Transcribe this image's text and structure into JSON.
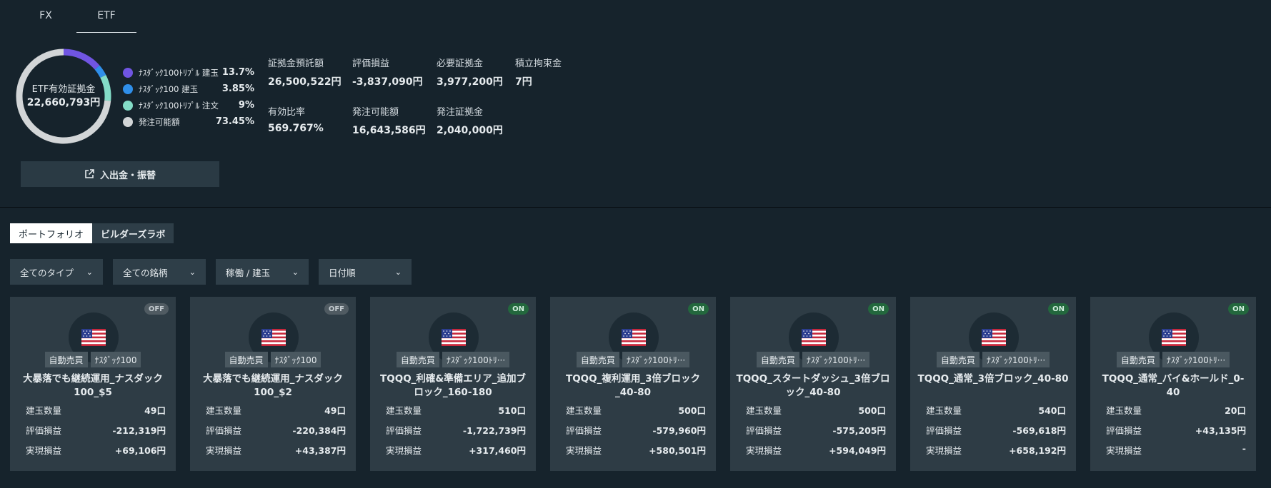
{
  "tabs_top": [
    {
      "label": "FX",
      "active": false
    },
    {
      "label": "ETF",
      "active": true
    }
  ],
  "summary": {
    "donut_title": "ETF有効証拠金",
    "donut_amount": "22,660,793円",
    "legend": [
      {
        "label": "ﾅｽﾀﾞｯｸ100ﾄﾘﾌﾟﾙ 建玉",
        "pct": "13.7%",
        "value": 13.7,
        "color": "#7055e2"
      },
      {
        "label": "ﾅｽﾀﾞｯｸ100 建玉",
        "pct": "3.85%",
        "value": 3.85,
        "color": "#2f8fea"
      },
      {
        "label": "ﾅｽﾀﾞｯｸ100ﾄﾘﾌﾟﾙ 注文",
        "pct": "9%",
        "value": 9,
        "color": "#83dcc7"
      },
      {
        "label": "発注可能額",
        "pct": "73.45%",
        "value": 73.45,
        "color": "#d2d5d7"
      }
    ],
    "stats": [
      {
        "label": "証拠金預託額",
        "value": "26,500,522円"
      },
      {
        "label": "評価損益",
        "value": "-3,837,090円"
      },
      {
        "label": "必要証拠金",
        "value": "3,977,200円"
      },
      {
        "label": "積立拘束金",
        "value": "7円"
      },
      {
        "label": "有効比率",
        "value": "569.767%"
      },
      {
        "label": "発注可能額",
        "value": "16,643,586円"
      },
      {
        "label": "発注証拠金",
        "value": "2,040,000円"
      }
    ],
    "deposit_button": "入出金・振替"
  },
  "tabs_sub": [
    {
      "label": "ポートフォリオ",
      "active": true
    },
    {
      "label": "ビルダーズラボ",
      "active": false
    }
  ],
  "filters": [
    {
      "label": "全てのタイプ"
    },
    {
      "label": "全ての銘柄"
    },
    {
      "label": "稼働 / 建玉"
    },
    {
      "label": "日付順"
    }
  ],
  "row_labels": {
    "qty": "建玉数量",
    "unrealized": "評価損益",
    "realized": "実現損益"
  },
  "cards": [
    {
      "status": "OFF",
      "tag1": "自動売買",
      "tag2": "ﾅｽﾀﾞｯｸ100",
      "title": "大暴落でも継続運用_ナスダック100_$5",
      "qty": "49口",
      "unrealized": "-212,319円",
      "realized": "+69,106円"
    },
    {
      "status": "OFF",
      "tag1": "自動売買",
      "tag2": "ﾅｽﾀﾞｯｸ100",
      "title": "大暴落でも継続運用_ナスダック100_$2",
      "qty": "49口",
      "unrealized": "-220,384円",
      "realized": "+43,387円"
    },
    {
      "status": "ON",
      "tag1": "自動売買",
      "tag2": "ﾅｽﾀﾞｯｸ100ﾄﾘ···",
      "title": "TQQQ_利確&準備エリア_追加ブロック_160-180",
      "qty": "510口",
      "unrealized": "-1,722,739円",
      "realized": "+317,460円"
    },
    {
      "status": "ON",
      "tag1": "自動売買",
      "tag2": "ﾅｽﾀﾞｯｸ100ﾄﾘ···",
      "title": "TQQQ_複利運用_3倍ブロック_40-80",
      "qty": "500口",
      "unrealized": "-579,960円",
      "realized": "+580,501円"
    },
    {
      "status": "ON",
      "tag1": "自動売買",
      "tag2": "ﾅｽﾀﾞｯｸ100ﾄﾘ···",
      "title": "TQQQ_スタートダッシュ_3倍ブロック_40-80",
      "qty": "500口",
      "unrealized": "-575,205円",
      "realized": "+594,049円"
    },
    {
      "status": "ON",
      "tag1": "自動売買",
      "tag2": "ﾅｽﾀﾞｯｸ100ﾄﾘ···",
      "title": "TQQQ_通常_3倍ブロック_40-80",
      "qty": "540口",
      "unrealized": "-569,618円",
      "realized": "+658,192円"
    },
    {
      "status": "ON",
      "tag1": "自動売買",
      "tag2": "ﾅｽﾀﾞｯｸ100ﾄﾘ···",
      "title": "TQQQ_通常_バイ&ホールド_0-40",
      "qty": "20口",
      "unrealized": "+43,135円",
      "realized": "-"
    }
  ]
}
